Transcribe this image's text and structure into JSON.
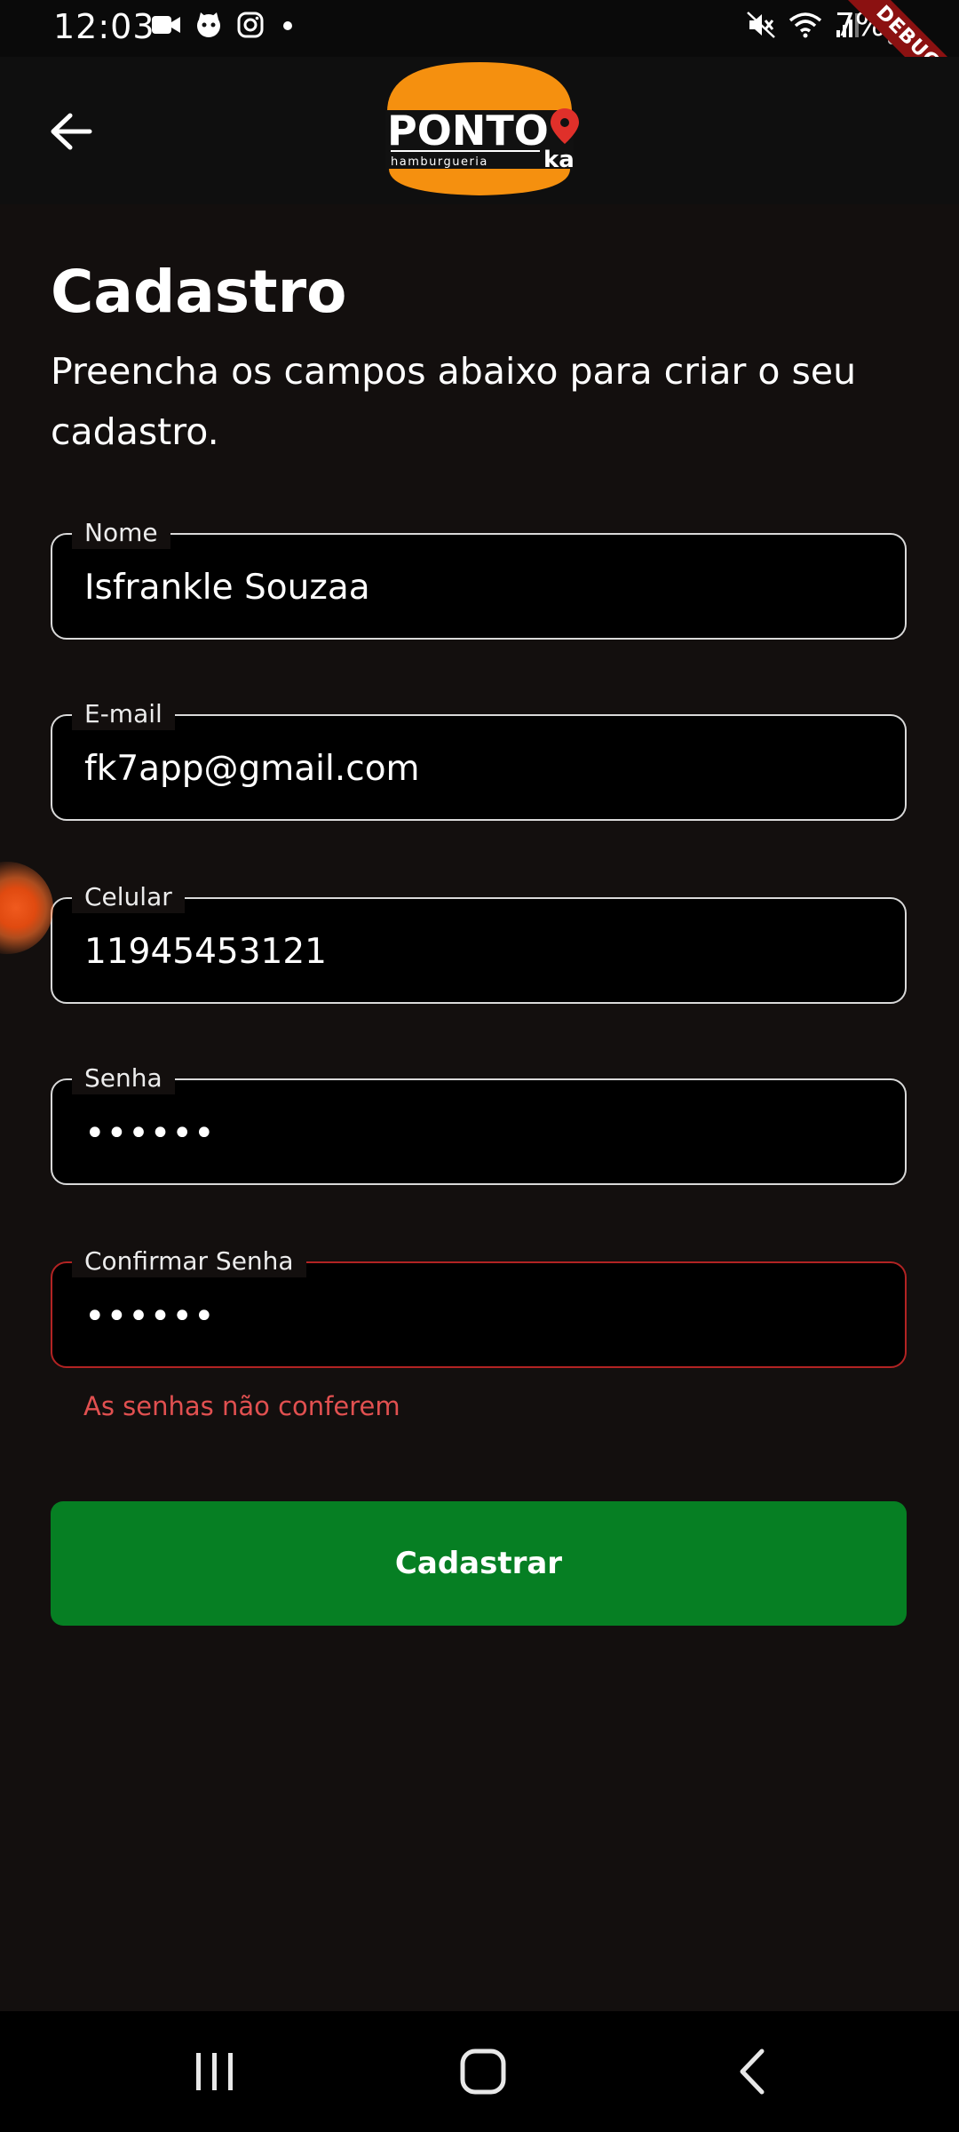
{
  "status_bar": {
    "time": "12:03",
    "battery": "7%",
    "icons_left": [
      "video-icon",
      "cat-icon",
      "instagram-icon",
      "dot-icon"
    ],
    "icons_right": [
      "mute-icon",
      "wifi-icon",
      "signal-icon",
      "battery-icon"
    ],
    "debug_banner": "DEBUG"
  },
  "app_bar": {
    "back_icon": "arrow-left-icon",
    "logo": {
      "brand": "PONTO",
      "suffix": "ka",
      "tagline": "hamburgueria",
      "colors": {
        "bun": "#f5900f",
        "patty": "#111111",
        "pin": "#e0302a"
      }
    }
  },
  "page": {
    "title": "Cadastro",
    "subtitle": "Preencha os campos abaixo para criar o seu cadastro."
  },
  "form": {
    "name": {
      "label": "Nome",
      "value": "Isfrankle Souzaa"
    },
    "email": {
      "label": "E-mail",
      "value": "fk7app@gmail.com"
    },
    "phone": {
      "label": "Celular",
      "value": "11945453121"
    },
    "password": {
      "label": "Senha",
      "value": "••••••"
    },
    "confirm_password": {
      "label": "Confirmar Senha",
      "value": "••••••",
      "error": "As senhas não conferem"
    },
    "submit_label": "Cadastrar"
  },
  "nav_bar": {
    "icons": [
      "recents-icon",
      "home-icon",
      "back-icon"
    ]
  },
  "colors": {
    "background": "#130f0e",
    "button": "#067f23",
    "error": "#b22323",
    "error_text": "#e15050"
  }
}
